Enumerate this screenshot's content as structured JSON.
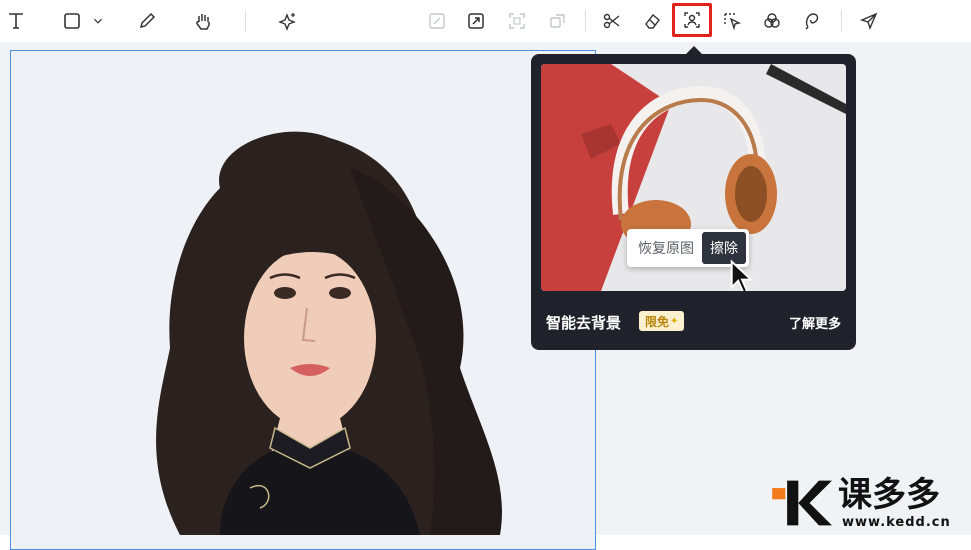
{
  "toolbar": {
    "tools": [
      "text-icon",
      "rectangle-icon",
      "chevron-down-icon",
      "pen-icon",
      "hand-icon",
      "ai-sparkle-icon",
      "edit-image-icon",
      "resize-icon",
      "crop-icon",
      "transform-icon",
      "scissors-icon",
      "eraser-icon",
      "remove-background-icon",
      "select-icon",
      "blend-icon",
      "lasso-icon",
      "send-icon"
    ],
    "selected_tool": "remove-background-icon",
    "selection_color": "#e2231a"
  },
  "popup": {
    "title": "智能去背景",
    "badge": "限免",
    "badge_star": "✦",
    "learn_more": "了解更多",
    "preview_menu": {
      "restore": "恢复原图",
      "erase": "擦除"
    }
  },
  "watermark": {
    "brand": "课多多",
    "url": "www.kedd.cn"
  },
  "colors": {
    "frame_border": "#4a90e2",
    "popup_bg": "#1f222a",
    "badge_bg": "#fbf1d0",
    "badge_text": "#b8860b"
  }
}
